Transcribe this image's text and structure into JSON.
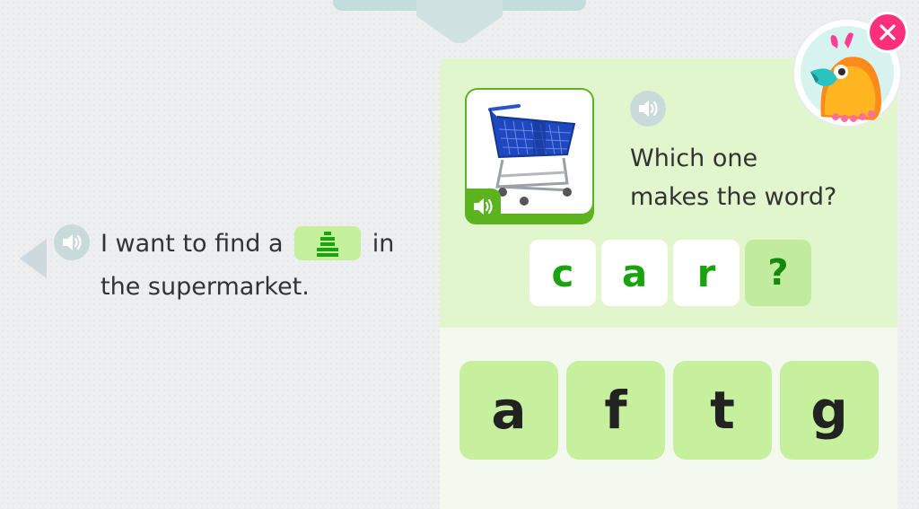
{
  "sentence": {
    "before": "I want to find a",
    "after_line1": "in",
    "line2": "the supermarket."
  },
  "question": {
    "line1": "Which one",
    "line2": "makes the word?"
  },
  "word_tiles": [
    "c",
    "a",
    "r",
    "?"
  ],
  "choices": [
    "a",
    "f",
    "t",
    "g"
  ],
  "icons": {
    "sentence_speaker": "speaker-icon",
    "question_speaker": "speaker-icon",
    "picture_speaker": "speaker-icon",
    "hidden_word": "stacked-bars-icon",
    "picture": "shopping-cart-icon",
    "mascot": "bird-mascot-icon",
    "close": "close-icon",
    "previous": "arrow-left-icon"
  },
  "colors": {
    "accent_green": "#5cb320",
    "letter_green": "#1aa30f",
    "choice_bg": "#c7f09e",
    "close_pink": "#ff2f7c"
  }
}
